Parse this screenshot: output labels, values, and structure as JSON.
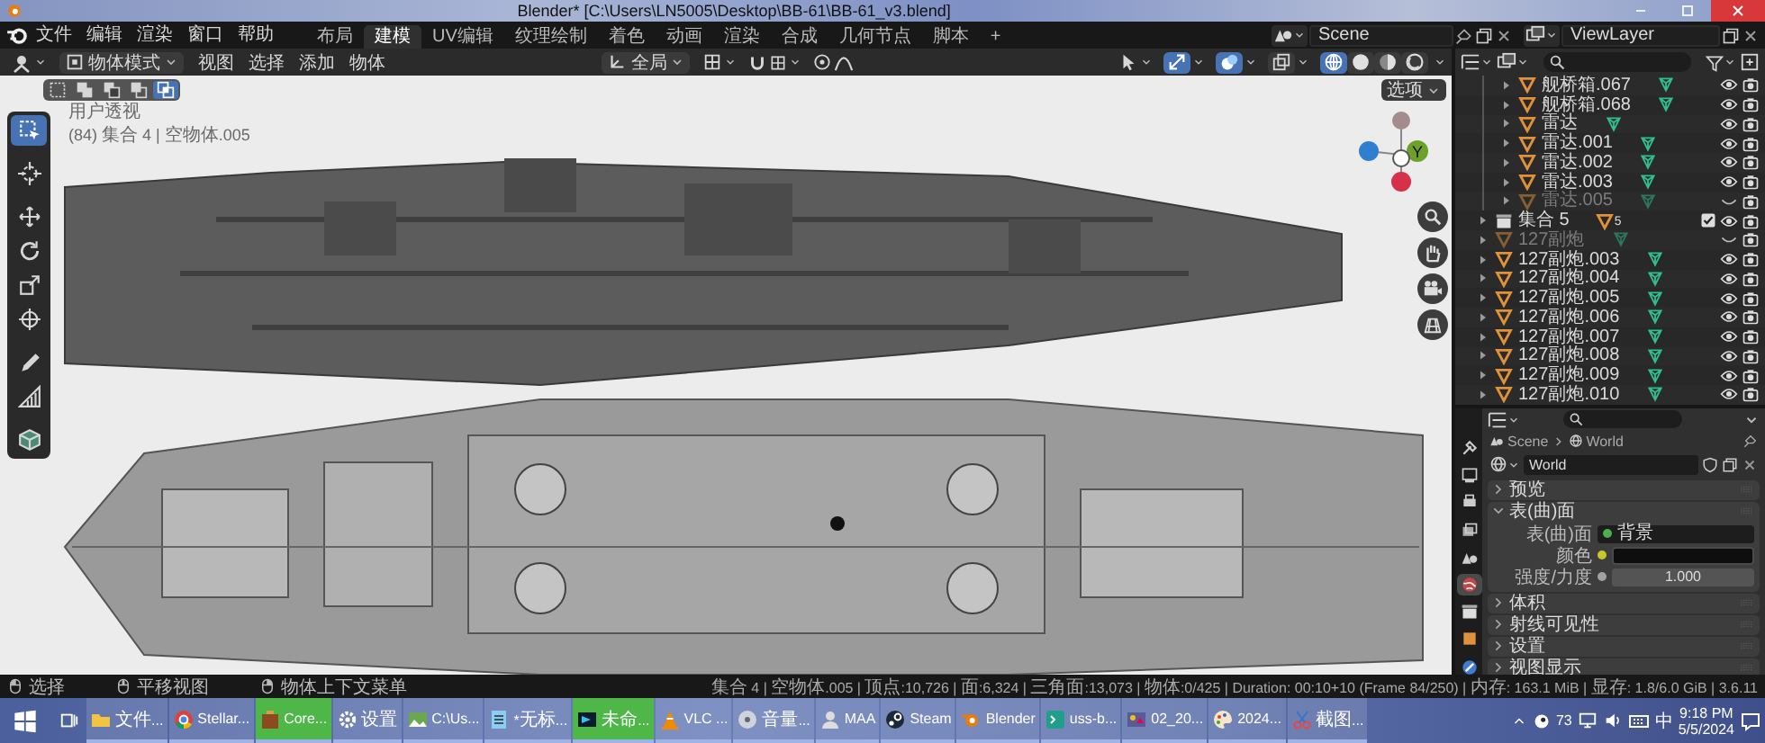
{
  "title_bar": {
    "title": "Blender* [C:\\Users\\LN5005\\Desktop\\BB-61\\BB-61_v3.blend]"
  },
  "menu_bar": {
    "menus": [
      "文件",
      "编辑",
      "渲染",
      "窗口",
      "帮助"
    ],
    "workspaces": [
      {
        "label": "布局",
        "selected": false
      },
      {
        "label": "建模",
        "selected": true
      },
      {
        "label": "UV编辑",
        "selected": false
      },
      {
        "label": "纹理绘制",
        "selected": false
      },
      {
        "label": "着色",
        "selected": false
      },
      {
        "label": "动画",
        "selected": false
      },
      {
        "label": "渲染",
        "selected": false
      },
      {
        "label": "合成",
        "selected": false
      },
      {
        "label": "几何节点",
        "selected": false
      },
      {
        "label": "脚本",
        "selected": false
      }
    ],
    "add_tab": "+",
    "scene": "Scene",
    "view_layer": "ViewLayer"
  },
  "viewport": {
    "mode": "物体模式",
    "menus": [
      "视图",
      "选择",
      "添加",
      "物体"
    ],
    "orientation": "全局",
    "toggles": [
      {
        "kind": "gizmo",
        "on": true
      },
      {
        "kind": "overlay",
        "on": true
      },
      {
        "kind": "xray",
        "on": false
      }
    ],
    "shading_modes": [
      {
        "kind": "wireframe",
        "selected": true
      },
      {
        "kind": "solid",
        "selected": false
      },
      {
        "kind": "material",
        "selected": false
      },
      {
        "kind": "rendered",
        "selected": false
      }
    ],
    "select_modes": [
      {
        "kind": "set",
        "selected": false
      },
      {
        "kind": "extend",
        "selected": false
      },
      {
        "kind": "subtract",
        "selected": false
      },
      {
        "kind": "difference",
        "selected": false
      },
      {
        "kind": "intersect",
        "selected": true
      }
    ],
    "options": "选项",
    "overlay_lines": [
      "用户透视",
      "(84) 集合 4 | 空物体.005"
    ],
    "tools": [
      {
        "kind": "select_box",
        "selected": true
      },
      {
        "kind": "cursor",
        "selected": false
      },
      {
        "kind": "move",
        "selected": false
      },
      {
        "kind": "rotate",
        "selected": false
      },
      {
        "kind": "scale",
        "selected": false
      },
      {
        "kind": "transform",
        "selected": false
      },
      {
        "kind": "annotate",
        "selected": false
      },
      {
        "kind": "measure",
        "selected": false
      },
      {
        "kind": "add_cube",
        "selected": false
      }
    ],
    "gizmo_label": "Y"
  },
  "outliner": {
    "nested_rows": [
      {
        "label": "舰桥箱.067",
        "kind": "mesh",
        "visible": true
      },
      {
        "label": "舰桥箱.068",
        "kind": "mesh",
        "visible": true
      },
      {
        "label": "雷达",
        "kind": "mesh",
        "visible": true
      },
      {
        "label": "雷达.001",
        "kind": "mesh",
        "visible": true
      },
      {
        "label": "雷达.002",
        "kind": "mesh",
        "visible": true
      },
      {
        "label": "雷达.003",
        "kind": "mesh",
        "visible": true
      },
      {
        "label": "雷达.005",
        "kind": "mesh",
        "visible": false
      }
    ],
    "rows": [
      {
        "label": "集合 5",
        "kind": "collection",
        "visible": true,
        "checked": true,
        "count": "5"
      },
      {
        "label": "127副炮",
        "kind": "mesh",
        "visible": false
      },
      {
        "label": "127副炮.003",
        "kind": "mesh",
        "visible": true
      },
      {
        "label": "127副炮.004",
        "kind": "mesh",
        "visible": true
      },
      {
        "label": "127副炮.005",
        "kind": "mesh",
        "visible": true
      },
      {
        "label": "127副炮.006",
        "kind": "mesh",
        "visible": true
      },
      {
        "label": "127副炮.007",
        "kind": "mesh",
        "visible": true
      },
      {
        "label": "127副炮.008",
        "kind": "mesh",
        "visible": true
      },
      {
        "label": "127副炮.009",
        "kind": "mesh",
        "visible": true
      },
      {
        "label": "127副炮.010",
        "kind": "mesh",
        "visible": true
      }
    ]
  },
  "properties": {
    "tabs": [
      {
        "kind": "tool",
        "selected": false
      },
      {
        "kind": "render",
        "selected": false
      },
      {
        "kind": "output",
        "selected": false
      },
      {
        "kind": "view_layer",
        "selected": false
      },
      {
        "kind": "scene",
        "selected": false
      },
      {
        "kind": "world",
        "selected": true
      },
      {
        "kind": "collection",
        "selected": false
      },
      {
        "kind": "object",
        "selected": false
      },
      {
        "kind": "modifier",
        "selected": false
      }
    ],
    "breadcrumb": [
      "Scene",
      "World"
    ],
    "datablock": "World",
    "panels": [
      {
        "title": "预览",
        "expanded": false
      },
      {
        "title": "表(曲)面",
        "expanded": true,
        "fields": [
          {
            "label": "表(曲)面",
            "kind": "shader",
            "value": "背景",
            "color": "#4caf50"
          },
          {
            "label": "颜色",
            "kind": "color",
            "color": "#c7c729"
          },
          {
            "label": "强度/力度",
            "kind": "number",
            "value": "1.000",
            "color": "#a1a1a1"
          }
        ]
      },
      {
        "title": "体积",
        "expanded": false
      },
      {
        "title": "射线可见性",
        "expanded": false
      },
      {
        "title": "设置",
        "expanded": false
      },
      {
        "title": "视图显示",
        "expanded": false
      }
    ]
  },
  "status_bar": {
    "hints": [
      {
        "kind": "left_click",
        "label": "选择"
      },
      {
        "kind": "middle_click",
        "label": "平移视图"
      },
      {
        "kind": "right_click",
        "label": "物体上下文菜单"
      }
    ],
    "stats": "集合 4 | 空物体.005 | 顶点:10,726 | 面:6,324 | 三角面:13,073 | 物体:0/425 | Duration: 00:10+10 (Frame 84/250) | 内存: 163.1 MiB | 显存: 1.8/6.0 GiB | 3.6.11"
  },
  "taskbar": {
    "apps": [
      {
        "kind": "folder",
        "label": "文件...",
        "highlighted": false
      },
      {
        "kind": "browser",
        "label": "Stellar...",
        "highlighted": false
      },
      {
        "kind": "tools",
        "label": "Core...",
        "highlighted": true
      },
      {
        "kind": "gear",
        "label": "设置",
        "highlighted": false
      },
      {
        "kind": "image",
        "label": "C:\\Us...",
        "highlighted": false
      },
      {
        "kind": "notepad",
        "label": "*无标...",
        "highlighted": false
      },
      {
        "kind": "video",
        "label": "未命...",
        "highlighted": true
      },
      {
        "kind": "cone",
        "label": "VLC ...",
        "highlighted": false
      },
      {
        "kind": "disc",
        "label": "音量...",
        "highlighted": false
      },
      {
        "kind": "avatar",
        "label": "MAA",
        "highlighted": false
      },
      {
        "kind": "steam",
        "label": "Steam",
        "highlighted": false
      },
      {
        "kind": "blender",
        "label": "Blender",
        "highlighted": false
      },
      {
        "kind": "terminal",
        "label": "uss-b...",
        "highlighted": false
      },
      {
        "kind": "media",
        "label": "02_20...",
        "highlighted": false
      },
      {
        "kind": "paint",
        "label": "2024...",
        "highlighted": false
      },
      {
        "kind": "snip",
        "label": "截图...",
        "highlighted": false
      }
    ],
    "tray": {
      "badge": "73",
      "ime": "中",
      "time": "9:18 PM",
      "date": "5/5/2024"
    }
  }
}
